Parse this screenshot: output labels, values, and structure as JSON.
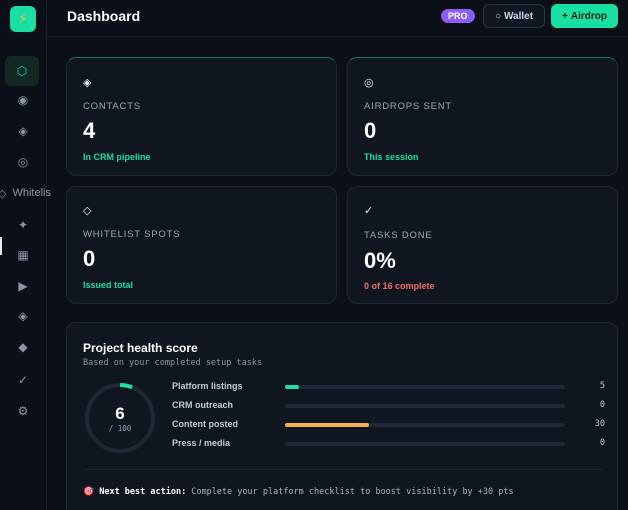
{
  "app": {
    "logo_glyph": "⚡",
    "accent": "#19e0a0"
  },
  "sidebar": {
    "items": [
      {
        "glyph": "⬡",
        "name": "hexagon-icon",
        "active": true
      },
      {
        "glyph": "◉",
        "name": "target-icon"
      },
      {
        "glyph": "◈",
        "name": "diamond-icon"
      },
      {
        "glyph": "◎",
        "name": "ring-icon"
      },
      {
        "glyph": "◇",
        "label": "Whitelis",
        "name": "whitelist-icon"
      },
      {
        "glyph": "✦",
        "name": "sparkle-icon"
      },
      {
        "glyph": "▦",
        "name": "grid-icon"
      },
      {
        "glyph": "▶",
        "name": "play-icon"
      },
      {
        "glyph": "◈",
        "name": "layers-icon"
      },
      {
        "glyph": "◆",
        "name": "gem-icon"
      },
      {
        "glyph": "✓",
        "name": "check-icon"
      },
      {
        "glyph": "⚙",
        "name": "gear-icon"
      }
    ]
  },
  "header": {
    "title": "Dashboard",
    "badge": "PRO",
    "wallet": {
      "icon": "○",
      "label": "Wallet"
    },
    "airdrop": {
      "icon": "+",
      "label": "Airdrop"
    }
  },
  "stats": [
    {
      "icon": "◈",
      "label": "CONTACTS",
      "value": "4",
      "sub": "In CRM pipeline",
      "sub_color": "#19e0a0"
    },
    {
      "icon": "◎",
      "label": "AIRDROPS SENT",
      "value": "0",
      "sub": "This session",
      "sub_color": "#19e0a0"
    },
    {
      "icon": "◇",
      "label": "WHITELIST SPOTS",
      "value": "0",
      "sub": "Issued total",
      "sub_color": "#19e0a0"
    },
    {
      "icon": "✓",
      "label": "TASKS DONE",
      "value": "0%",
      "sub": "0 of 16 complete",
      "sub_color": "#f26b6b"
    }
  ],
  "health": {
    "title": "Project health score",
    "subtitle": "Based on your completed setup tasks",
    "score": "6",
    "score_max": "/ 100",
    "score_fraction": 0.06,
    "metrics": [
      {
        "label": "Platform listings",
        "value": "5",
        "fill_fraction": 0.05,
        "color": "#19e0a0"
      },
      {
        "label": "CRM outreach",
        "value": "0",
        "fill_fraction": 0,
        "color": "#19e0a0"
      },
      {
        "label": "Content posted",
        "value": "30",
        "fill_fraction": 0.3,
        "color": "#f5b14c"
      },
      {
        "label": "Press / media",
        "value": "0",
        "fill_fraction": 0,
        "color": "#19e0a0"
      }
    ],
    "next_action": {
      "icon": "🎯",
      "lead": "Next best action:",
      "text": "Complete your platform checklist to boost visibility by +30 pts"
    }
  }
}
